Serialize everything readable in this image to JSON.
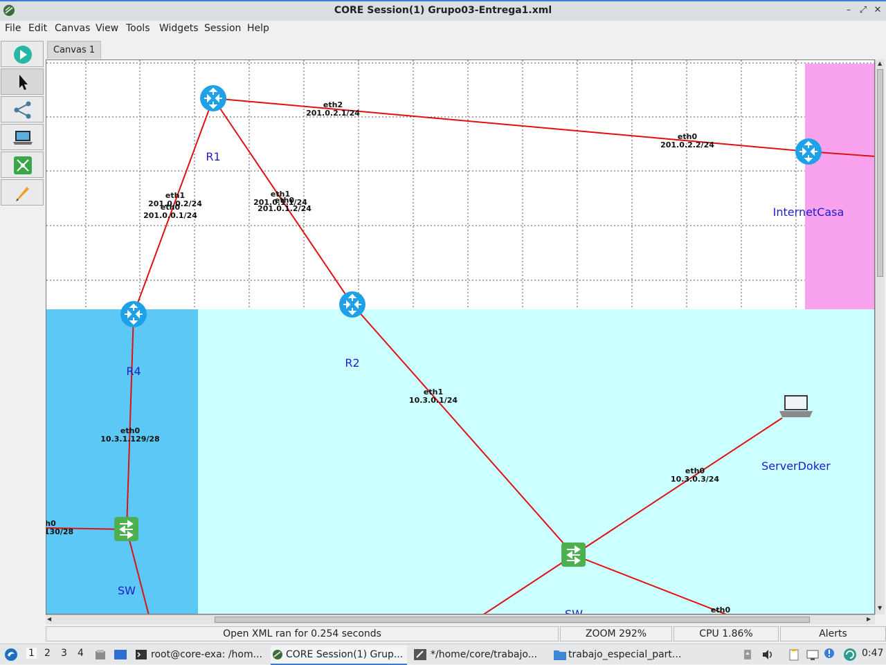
{
  "window": {
    "title": "CORE Session(1) Grupo03-Entrega1.xml"
  },
  "menu": [
    "File",
    "Edit",
    "Canvas",
    "View",
    "Tools",
    "Widgets",
    "Session",
    "Help"
  ],
  "toolbar": {
    "tools": [
      {
        "icon": "play-icon",
        "name": "start-session-button"
      },
      {
        "icon": "pointer-icon",
        "name": "select-tool-button"
      },
      {
        "icon": "link-icon",
        "name": "link-tool-button"
      },
      {
        "icon": "laptop-icon",
        "name": "node-tool-button"
      },
      {
        "icon": "network-icon",
        "name": "network-tool-button"
      },
      {
        "icon": "pencil-icon",
        "name": "annotation-tool-button"
      }
    ]
  },
  "tabs": [
    {
      "label": "Canvas 1"
    }
  ],
  "canvas": {
    "colors": {
      "link": "#e01010",
      "router": "#1ea1e6",
      "switch": "#4caf50",
      "zone_blue": "#5bc8f5",
      "zone_cyan": "#ccffff",
      "zone_pink": "#f9a3ef",
      "label": "#1c1ccc"
    },
    "nodes": {
      "r1": {
        "label": "R1"
      },
      "r2": {
        "label": "R2"
      },
      "r4": {
        "label": "R4"
      },
      "internet": {
        "label": "InternetCasa"
      },
      "sw_left": {
        "label": "SW"
      },
      "sw_main": {
        "label": "SW"
      },
      "server": {
        "label": "ServerDoker"
      }
    },
    "interfaces": {
      "r1_eth2_name": "eth2",
      "r1_eth2_ip": "201.0.2.1/24",
      "inet_eth0_name": "eth0",
      "inet_eth0_ip": "201.0.2.2/24",
      "r1_eth1_name": "eth1",
      "r1_eth1_ip": "201.0.0.2/24",
      "r4_eth0_name": "eth0",
      "r4_eth0_ip": "201.0.0.1/24",
      "r1_eth1b_name": "eth1",
      "r1_eth1b_ip": "201.0.1.1/24",
      "r2_eth0_name": "eth0",
      "r2_eth0_ip": "201.0.1.2/24",
      "r2_eth1_name": "eth1",
      "r2_eth1_ip": "10.3.0.1/24",
      "r4_eth0b_name": "eth0",
      "r4_eth0b_ip": "10.3.1.129/28",
      "left_edge_name": "h0",
      "left_edge_ip": "130/28",
      "server_eth0_name": "eth0",
      "server_eth0_ip": "10.3.0.3/24",
      "bottom_eth0_name": "eth0"
    }
  },
  "status": {
    "message": "Open XML ran for 0.254 seconds",
    "zoom": "ZOOM 292%",
    "cpu": "CPU 1.86%",
    "alerts": "Alerts"
  },
  "taskbar": {
    "workspaces": [
      "1",
      "2",
      "3",
      "4"
    ],
    "tasks": [
      {
        "label": "root@core-exa: /hom...",
        "icon": "terminal-icon"
      },
      {
        "label": "CORE Session(1) Grup...",
        "icon": "core-icon"
      },
      {
        "label": "*/home/core/trabajo...",
        "icon": "editor-icon"
      },
      {
        "label": "trabajo_especial_part...",
        "icon": "folder-icon"
      }
    ],
    "clock": "0:47"
  }
}
